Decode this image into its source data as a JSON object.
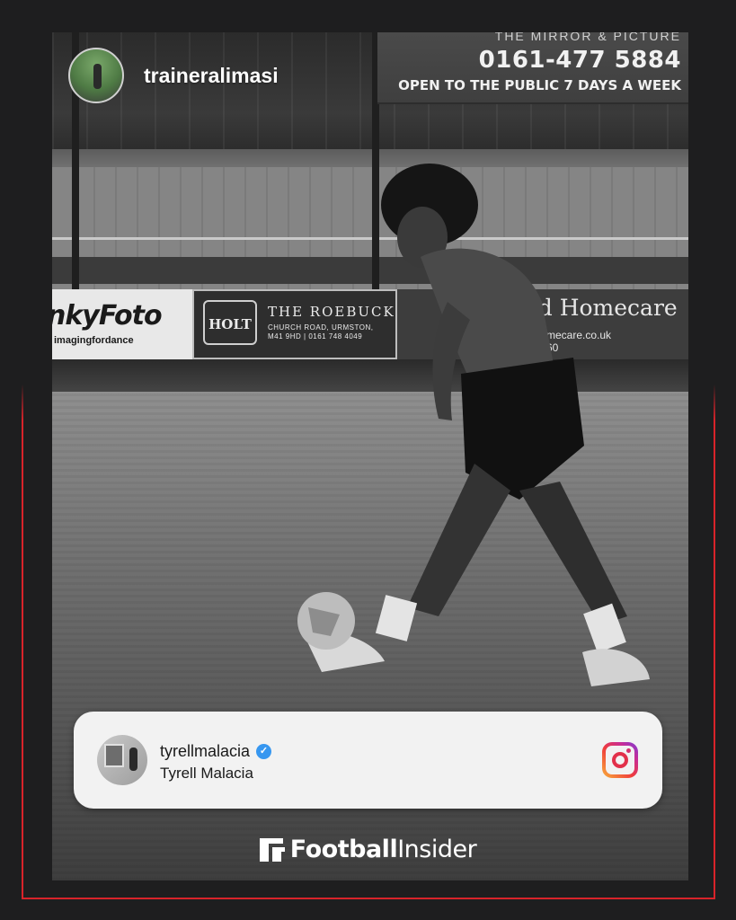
{
  "post": {
    "author_handle": "traineralimasi"
  },
  "background_signage": {
    "top_sign_partial": "THE MIRROR & PICTURE",
    "top_sign_phone": "0161-477 5884",
    "top_sign_hours": "OPEN TO THE PUBLIC 7 DAYS A WEEK",
    "ad_left_name": "nkyFoto",
    "ad_left_sub": "imagingfordance",
    "ad_middle_logo": "HOLT",
    "ad_middle_title": "THE ROEBUCK",
    "ad_middle_address_1": "CHURCH ROAD, URMSTON,",
    "ad_middle_address_2": "M41 9HD | 0161 748 4049",
    "ad_right_name": "red Homecare",
    "ad_right_url": "mecare.co.uk",
    "ad_right_number": "60"
  },
  "instagram_card": {
    "username": "tyrellmalacia",
    "full_name": "Tyrell Malacia",
    "verified": true,
    "verified_color": "#3797f0",
    "platform_icon": "instagram-icon"
  },
  "brand": {
    "bold": "Football",
    "light": "Insider",
    "accent_color": "#d8232a"
  }
}
